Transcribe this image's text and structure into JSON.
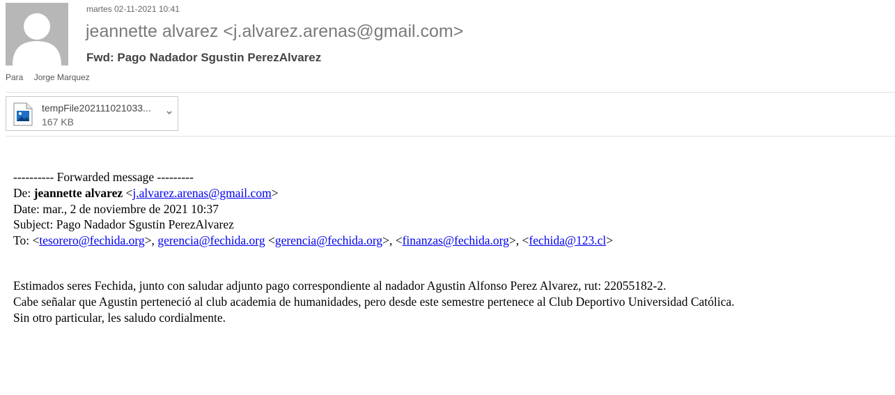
{
  "header": {
    "date": "martes 02-11-2021 10:41",
    "sender": "jeannette alvarez <j.alvarez.arenas@gmail.com>",
    "subject": "Fwd: Pago Nadador Sgustin PerezAlvarez",
    "to_label": "Para",
    "to_value": "Jorge Marquez",
    "avatar_icon": "person-silhouette-icon"
  },
  "attachment": {
    "file_name": "tempFile202111021033...",
    "file_size": "167 KB",
    "file_icon": "image-file-icon",
    "menu_icon": "chevron-down-icon"
  },
  "forwarded": {
    "banner": "---------- Forwarded message ---------",
    "from_label": "De: ",
    "from_name": "jeannette alvarez",
    "from_open": " <",
    "from_email": "j.alvarez.arenas@gmail.com",
    "from_close": ">",
    "date_line": "Date: mar., 2 de noviembre de 2021 10:37",
    "subject_line": "Subject: Pago Nadador Sgustin PerezAlvarez",
    "to_label": "To: <",
    "to_emails": [
      "tesorero@fechida.org",
      "gerencia@fechida.org",
      "gerencia@fechida.org",
      "finanzas@fechida.org",
      "fechida@123.cl"
    ],
    "to_sep1": ">, ",
    "to_sep2": " <",
    "to_sep3": ">, <",
    "to_sep4": ">, <",
    "to_end": ">"
  },
  "message": {
    "line1": "Estimados seres Fechida, junto con saludar adjunto pago correspondiente al nadador Agustin Alfonso Perez Alvarez, rut: 22055182-2.",
    "line2": "Cabe señalar que Agustin perteneció al club academia de humanidades, pero desde este semestre  pertenece al Club Deportivo Universidad Católica.",
    "line3": "Sin otro particular, les saludo cordialmente."
  }
}
